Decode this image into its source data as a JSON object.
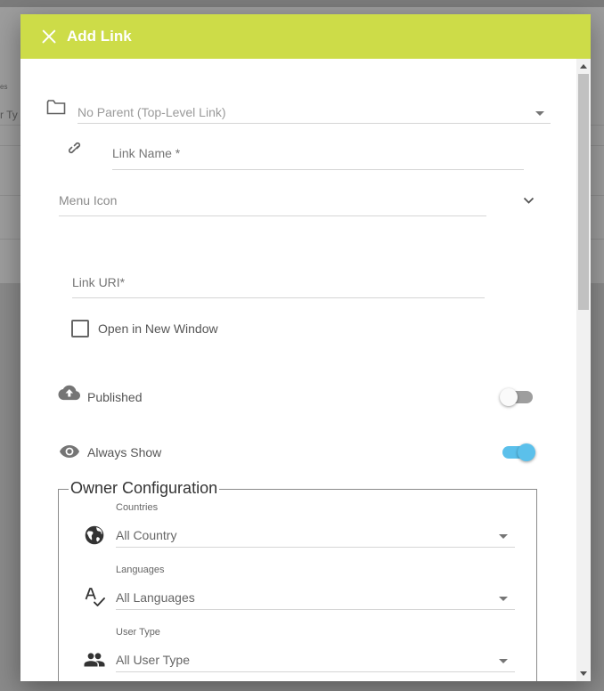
{
  "background": {
    "fragment_top": "es",
    "fragment_left": "r Ty"
  },
  "dialog": {
    "title": "Add Link",
    "close_icon": "close-icon"
  },
  "form": {
    "parent_select": {
      "value": "No Parent (Top-Level Link)",
      "icon": "folder-icon"
    },
    "link_name": {
      "placeholder": "Link Name *",
      "icon": "link-icon"
    },
    "menu_icon": {
      "label": "Menu Icon"
    },
    "link_uri": {
      "placeholder": "Link URI*"
    },
    "open_new_window": {
      "label": "Open in New Window",
      "checked": false
    },
    "published": {
      "label": "Published",
      "enabled": false,
      "icon": "cloud-upload-icon"
    },
    "always_show": {
      "label": "Always Show",
      "enabled": true,
      "icon": "eye-icon"
    }
  },
  "owner_configuration": {
    "legend": "Owner Configuration",
    "countries": {
      "label": "Countries",
      "value": "All Country",
      "icon": "globe-icon"
    },
    "languages": {
      "label": "Languages",
      "value": "All Languages",
      "icon": "spellcheck-icon"
    },
    "user_type": {
      "label": "User Type",
      "value": "All User Type",
      "icon": "people-icon"
    }
  },
  "colors": {
    "header": "#cddc48",
    "toggle_on": "#5bc0eb",
    "toggle_off": "#9e9e9e"
  }
}
